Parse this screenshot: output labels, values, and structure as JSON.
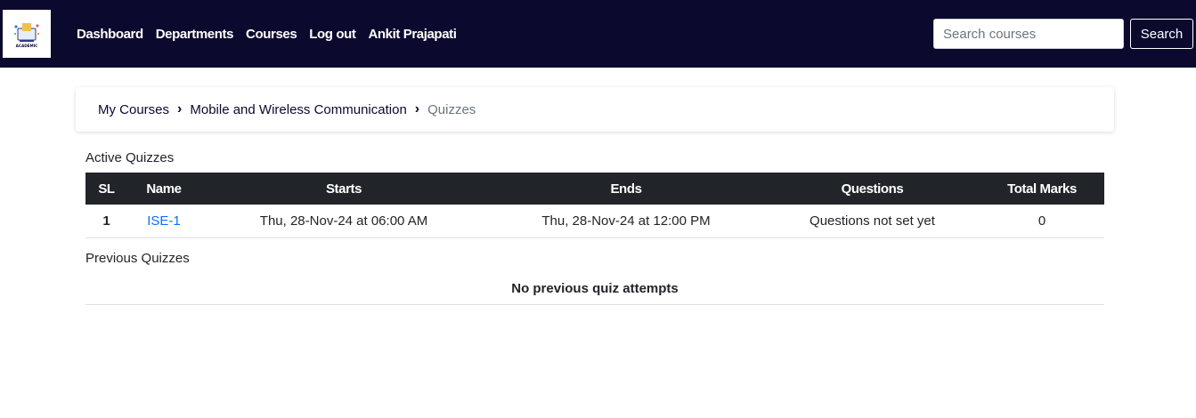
{
  "colors": {
    "navbar_bg": "#0b0a2e",
    "table_header_bg": "#212529",
    "link": "#0d6efd",
    "breadcrumb_active": "#6c757d"
  },
  "navbar": {
    "logo_icon": "academic-logo-icon",
    "logo_text": "ACADEMIC",
    "links": [
      "Dashboard",
      "Departments",
      "Courses",
      "Log out",
      "Ankit Prajapati"
    ],
    "search": {
      "placeholder": "Search courses",
      "value": "",
      "button_label": "Search"
    }
  },
  "breadcrumb": {
    "items": [
      "My Courses",
      "Mobile and Wireless Communication"
    ],
    "separator": "›",
    "active": "Quizzes"
  },
  "active_quizzes": {
    "title": "Active Quizzes",
    "columns": [
      "SL",
      "Name",
      "Starts",
      "Ends",
      "Questions",
      "Total Marks"
    ],
    "rows": [
      {
        "sl": "1",
        "name": "ISE-1",
        "starts": "Thu, 28-Nov-24 at 06:00 AM",
        "ends": "Thu, 28-Nov-24 at 12:00 PM",
        "questions": "Questions not set yet",
        "total_marks": "0"
      }
    ]
  },
  "previous_quizzes": {
    "title": "Previous Quizzes",
    "empty_message": "No previous quiz attempts"
  }
}
